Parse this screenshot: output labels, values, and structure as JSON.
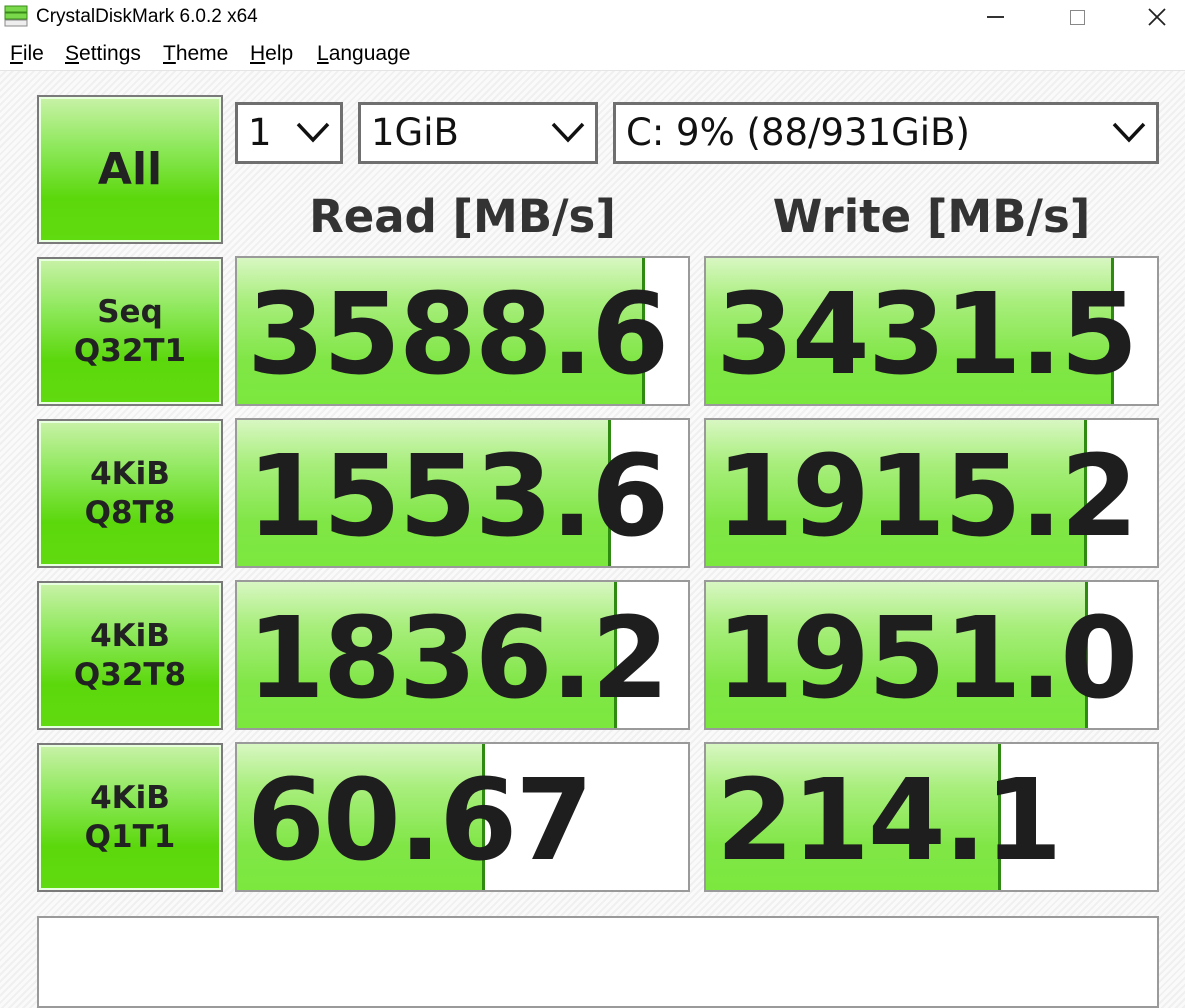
{
  "window": {
    "title": "CrystalDiskMark 6.0.2 x64"
  },
  "menu": [
    {
      "pre": "",
      "u": "F",
      "post": "ile"
    },
    {
      "pre": "",
      "u": "S",
      "post": "ettings"
    },
    {
      "pre": "",
      "u": "T",
      "post": "heme"
    },
    {
      "pre": "",
      "u": "H",
      "post": "elp"
    },
    {
      "pre": "",
      "u": "L",
      "post": "anguage"
    }
  ],
  "controls": {
    "all_label": "All",
    "count": "1",
    "size": "1GiB",
    "drive": "C: 9% (88/931GiB)"
  },
  "headers": {
    "read": "Read [MB/s]",
    "write": "Write [MB/s]"
  },
  "tests": [
    {
      "line1": "Seq",
      "line2": "Q32T1",
      "read": "3588.6",
      "write": "3431.5",
      "read_fill": 0.905,
      "write_fill": 0.905
    },
    {
      "line1": "4KiB",
      "line2": "Q8T8",
      "read": "1553.6",
      "write": "1915.2",
      "read_fill": 0.83,
      "write_fill": 0.845
    },
    {
      "line1": "4KiB",
      "line2": "Q32T8",
      "read": "1836.2",
      "write": "1951.0",
      "read_fill": 0.843,
      "write_fill": 0.846
    },
    {
      "line1": "4KiB",
      "line2": "Q1T1",
      "read": "60.67",
      "write": "214.1",
      "read_fill": 0.55,
      "write_fill": 0.655
    }
  ],
  "comment": "",
  "colors": {
    "accent_green": "#5bd80c",
    "bar_green": "#80e646",
    "border": "#9a9a9a"
  }
}
